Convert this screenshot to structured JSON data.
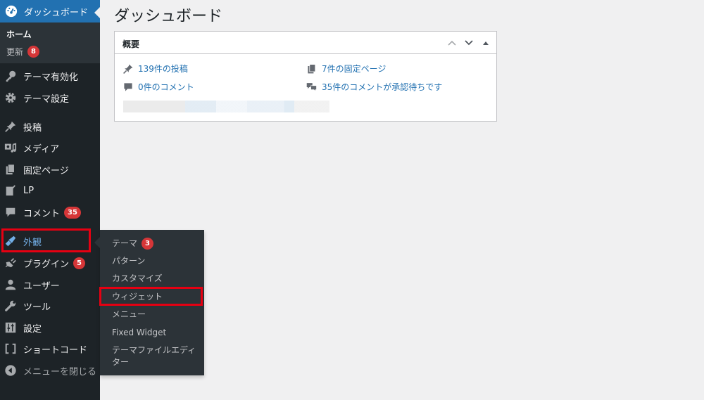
{
  "sidebar": {
    "dashboard_label": "ダッシュボード",
    "sub": {
      "home": "ホーム",
      "updates": "更新",
      "updates_count": "8"
    },
    "items": [
      {
        "label": "テーマ有効化",
        "icon": "key-icon"
      },
      {
        "label": "テーマ設定",
        "icon": "gear-icon"
      },
      {
        "label": "投稿",
        "icon": "pin-icon"
      },
      {
        "label": "メディア",
        "icon": "media-icon"
      },
      {
        "label": "固定ページ",
        "icon": "pages-icon"
      },
      {
        "label": "LP",
        "icon": "edit-page-icon"
      },
      {
        "label": "コメント",
        "icon": "comment-icon",
        "badge": "35"
      },
      {
        "label": "外観",
        "icon": "brush-icon",
        "active": true
      },
      {
        "label": "プラグイン",
        "icon": "plugin-icon",
        "badge": "5"
      },
      {
        "label": "ユーザー",
        "icon": "user-icon"
      },
      {
        "label": "ツール",
        "icon": "wrench-icon"
      },
      {
        "label": "設定",
        "icon": "settings-icon"
      },
      {
        "label": "ショートコード",
        "icon": "brackets-icon"
      },
      {
        "label": "メニューを閉じる",
        "icon": "collapse-icon"
      }
    ]
  },
  "flyout": {
    "items": [
      {
        "label": "テーマ",
        "badge": "3"
      },
      {
        "label": "パターン"
      },
      {
        "label": "カスタマイズ"
      },
      {
        "label": "ウィジェット",
        "highlighted": true
      },
      {
        "label": "メニュー"
      },
      {
        "label": "Fixed Widget"
      },
      {
        "label": "テーマファイルエディター"
      }
    ]
  },
  "main": {
    "title": "ダッシュボード",
    "glance": {
      "title": "概要",
      "posts": "139件の投稿",
      "pages": "7件の固定ページ",
      "comments": "0件のコメント",
      "pending": "35件のコメントが承認待ちです"
    }
  },
  "colors": {
    "accent": "#2271b1",
    "sidebar": "#1d2327",
    "highlight": "#e60012",
    "badge": "#d63638"
  }
}
